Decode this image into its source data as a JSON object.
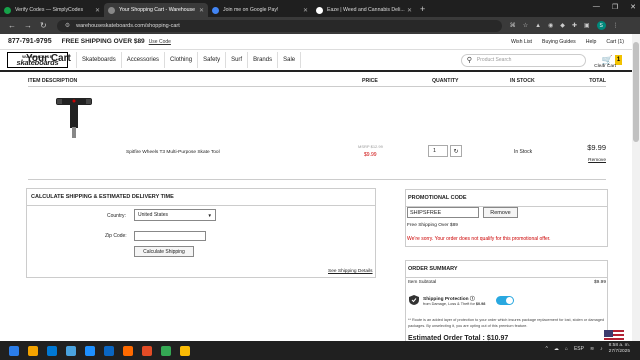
{
  "browser": {
    "tabs": [
      {
        "label": "Verify Codes — SimplyCodes",
        "color": "#16a34a"
      },
      {
        "label": "Your Shopping Cart - Warehouse",
        "color": "#888888"
      },
      {
        "label": "Join me on Google Pay!",
        "color": "#4285f4"
      },
      {
        "label": "Eaze | Weed and Cannabis Deli...",
        "color": "#222222"
      }
    ],
    "new_tab": "+",
    "url": "warehouseskateboards.com/shopping-cart",
    "window_controls": [
      "—",
      "❐",
      "✕"
    ]
  },
  "topstrip": {
    "phone": "877-791-9795",
    "shipping": "FREE SHIPPING OVER $89",
    "use_code": "Use Code",
    "links": [
      "Wish List",
      "Buying Guides",
      "Help",
      "Cart (1)"
    ]
  },
  "logo": {
    "top": "WAREHOUSE",
    "bottom": "skateboards"
  },
  "nav": {
    "items": [
      "Skateboards",
      "Accessories",
      "Clothing",
      "Safety",
      "Surf",
      "Brands",
      "Sale"
    ],
    "search_placeholder": "Product Search",
    "cart_count": "1"
  },
  "cart": {
    "title": "Your Cart",
    "clear": "Clear Cart",
    "headers": {
      "item": "ITEM DESCRIPTION",
      "price": "PRICE",
      "qty": "QUANTITY",
      "stock": "IN STOCK",
      "total": "TOTAL"
    },
    "item": {
      "name": "Spitfire Wheels T3 Multi-Purpose Skate Tool",
      "msrp": "MSRP $12.99",
      "price": "$9.99",
      "qty": "1",
      "stock": "In Stock",
      "total": "$9.99",
      "remove": "Remove"
    }
  },
  "shipping": {
    "title": "CALCULATE SHIPPING & ESTIMATED DELIVERY TIME",
    "country_label": "Country:",
    "country_value": "United States",
    "zip_label": "Zip Code:",
    "calc_button": "Calculate Shipping",
    "details_link": "See Shipping Details"
  },
  "promo": {
    "title": "PROMOTIONAL CODE",
    "code": "SHIPSFREE",
    "remove": "Remove",
    "free_text": "Free Shipping Over $89",
    "error": "We're sorry. Your order does not qualify for this promotional offer."
  },
  "summary": {
    "title": "ORDER SUMMARY",
    "subtotal_label": "Item Subtotal",
    "subtotal_value": "$9.99",
    "protection_title": "Shipping Protection",
    "protection_sub": "from Damage, Loss & Theft for",
    "protection_price": "$0.98",
    "protection_note": "** Route is an added layer of protection to your order which insures package replacement for lost, stolen or damaged packages. By unselecting it, you are opting out of this premium feature.",
    "estimated_total": "Estimated Order Total : $10.97"
  },
  "taskbar": {
    "icons": [
      "#2b7de9",
      "#f4a300",
      "#0078d4",
      "#4aa3df",
      "#1e90ff",
      "#0a66c2",
      "#ff6a00",
      "#e34c26",
      "#34a853",
      "#fbbc05"
    ],
    "lang": "ESP",
    "time": "8:58 a. m.",
    "date": "27/7/2025"
  }
}
